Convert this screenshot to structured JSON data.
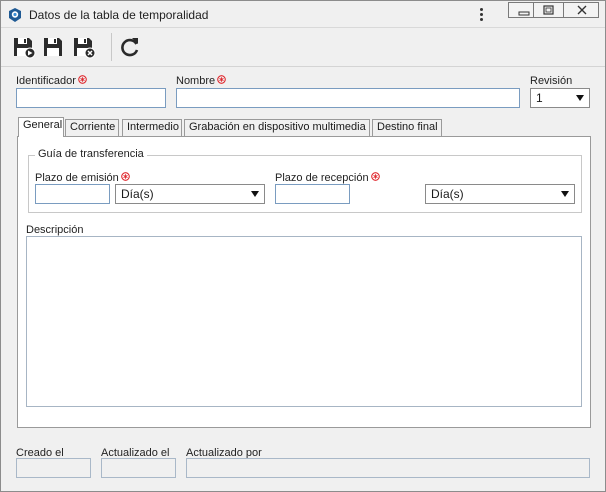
{
  "window": {
    "title": "Datos de la tabla de temporalidad"
  },
  "toolbar": {
    "icons": [
      "save-new-icon",
      "save-icon",
      "save-close-icon",
      "refresh-icon"
    ]
  },
  "form": {
    "identificador_label": "Identificador",
    "identificador_value": "",
    "nombre_label": "Nombre",
    "nombre_value": "",
    "revision_label": "Revisión",
    "revision_value": "1"
  },
  "tabs": [
    {
      "label": "General",
      "active": true
    },
    {
      "label": "Corriente",
      "active": false
    },
    {
      "label": "Intermedio",
      "active": false
    },
    {
      "label": "Grabación en dispositivo multimedia",
      "active": false
    },
    {
      "label": "Destino final",
      "active": false
    }
  ],
  "general": {
    "group_title": "Guía de transferencia",
    "plazo_emision_label": "Plazo de emisión",
    "plazo_emision_value": "",
    "plazo_emision_unit": "Día(s)",
    "plazo_recepcion_label": "Plazo de recepción",
    "plazo_recepcion_value": "",
    "plazo_recepcion_unit": "Día(s)",
    "descripcion_label": "Descripción",
    "descripcion_value": ""
  },
  "footer": {
    "creado_label": "Creado el",
    "creado_value": "",
    "actualizado_label": "Actualizado el",
    "actualizado_value": "",
    "actualizado_por_label": "Actualizado por",
    "actualizado_por_value": ""
  },
  "colors": {
    "required_marker": "#e0282e",
    "app_icon": "#1f5a94",
    "input_border": "#7a9cc0"
  }
}
